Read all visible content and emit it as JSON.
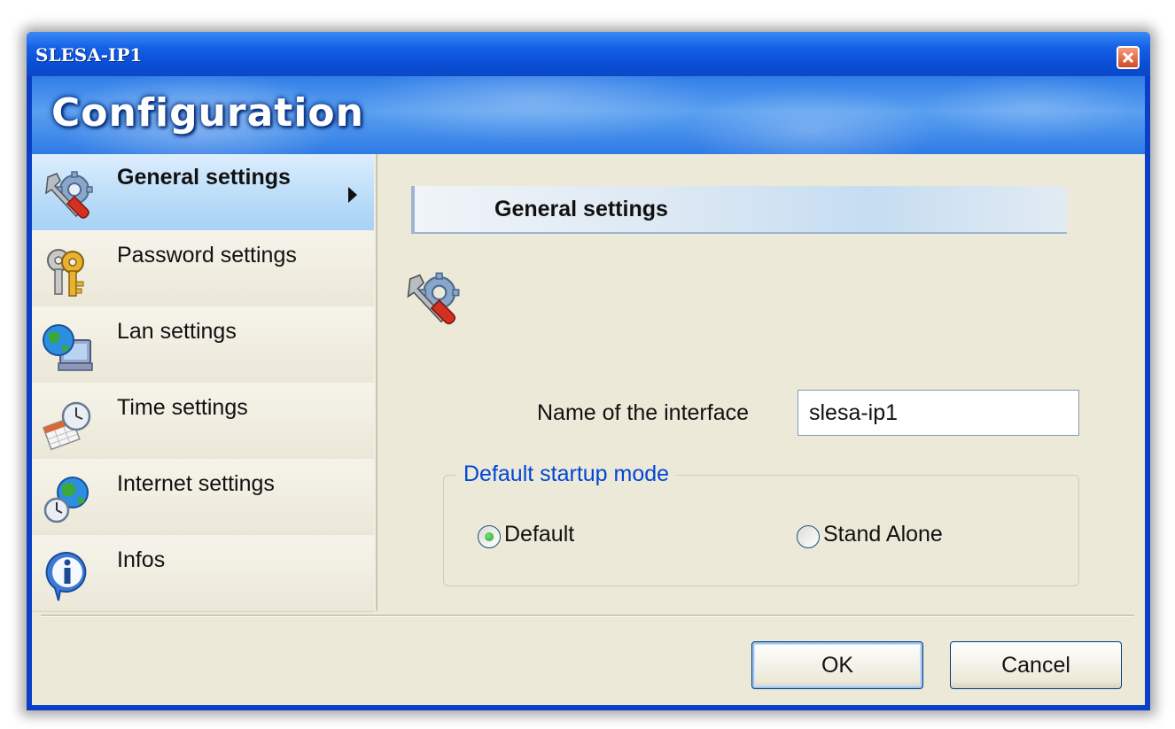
{
  "window": {
    "title": "SLESA-IP1",
    "banner_title": "Configuration"
  },
  "sidebar": {
    "items": [
      {
        "label": "General settings",
        "icon": "settings-wrench-gear-icon",
        "active": true
      },
      {
        "label": "Password settings",
        "icon": "keys-icon",
        "active": false
      },
      {
        "label": "Lan settings",
        "icon": "network-globe-computer-icon",
        "active": false
      },
      {
        "label": "Time settings",
        "icon": "clock-calendar-icon",
        "active": false
      },
      {
        "label": "Internet settings",
        "icon": "globe-clock-icon",
        "active": false
      },
      {
        "label": "Infos",
        "icon": "info-icon",
        "active": false
      }
    ]
  },
  "main": {
    "section_title": "General settings",
    "interface_name_label": "Name of the interface",
    "interface_name_value": "slesa-ip1",
    "startup_group_title": "Default startup mode",
    "startup_options": [
      {
        "label": "Default",
        "selected": true
      },
      {
        "label": "Stand Alone",
        "selected": false
      }
    ]
  },
  "buttons": {
    "ok_label": "OK",
    "cancel_label": "Cancel"
  },
  "colors": {
    "title_bar": "#0a4fd6",
    "client_bg": "#ece9d8",
    "group_title": "#0046d5",
    "active_item": "#b9dcf8"
  }
}
